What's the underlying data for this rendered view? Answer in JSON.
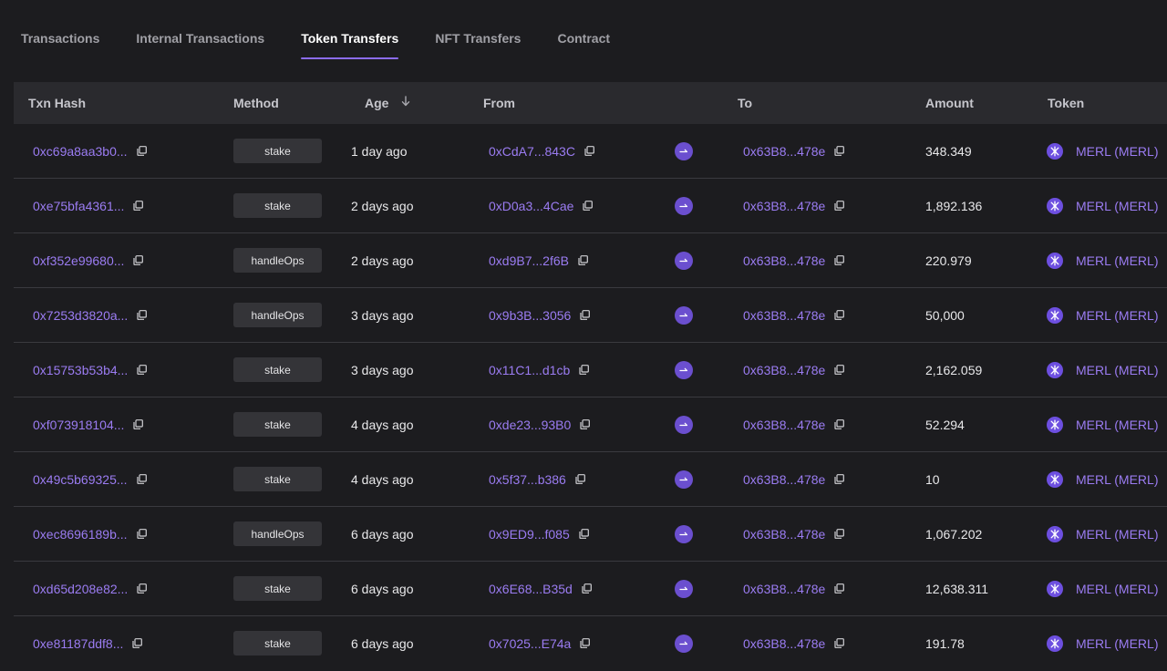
{
  "tabs": [
    {
      "label": "Transactions",
      "active": false
    },
    {
      "label": "Internal Transactions",
      "active": false
    },
    {
      "label": "Token Transfers",
      "active": true
    },
    {
      "label": "NFT Transfers",
      "active": false
    },
    {
      "label": "Contract",
      "active": false
    }
  ],
  "table": {
    "headers": {
      "txn_hash": "Txn Hash",
      "method": "Method",
      "age": "Age",
      "from": "From",
      "to": "To",
      "amount": "Amount",
      "token": "Token"
    },
    "rows": [
      {
        "hash": "0xc69a8aa3b0...",
        "method": "stake",
        "age": "1 day ago",
        "from": "0xCdA7...843C",
        "to": "0x63B8...478e",
        "amount": "348.349",
        "token": "MERL (MERL)"
      },
      {
        "hash": "0xe75bfa4361...",
        "method": "stake",
        "age": "2 days ago",
        "from": "0xD0a3...4Cae",
        "to": "0x63B8...478e",
        "amount": "1,892.136",
        "token": "MERL (MERL)"
      },
      {
        "hash": "0xf352e99680...",
        "method": "handleOps",
        "age": "2 days ago",
        "from": "0xd9B7...2f6B",
        "to": "0x63B8...478e",
        "amount": "220.979",
        "token": "MERL (MERL)"
      },
      {
        "hash": "0x7253d3820a...",
        "method": "handleOps",
        "age": "3 days ago",
        "from": "0x9b3B...3056",
        "to": "0x63B8...478e",
        "amount": "50,000",
        "token": "MERL (MERL)"
      },
      {
        "hash": "0x15753b53b4...",
        "method": "stake",
        "age": "3 days ago",
        "from": "0x11C1...d1cb",
        "to": "0x63B8...478e",
        "amount": "2,162.059",
        "token": "MERL (MERL)"
      },
      {
        "hash": "0xf073918104...",
        "method": "stake",
        "age": "4 days ago",
        "from": "0xde23...93B0",
        "to": "0x63B8...478e",
        "amount": "52.294",
        "token": "MERL (MERL)"
      },
      {
        "hash": "0x49c5b69325...",
        "method": "stake",
        "age": "4 days ago",
        "from": "0x5f37...b386",
        "to": "0x63B8...478e",
        "amount": "10",
        "token": "MERL (MERL)"
      },
      {
        "hash": "0xec8696189b...",
        "method": "handleOps",
        "age": "6 days ago",
        "from": "0x9ED9...f085",
        "to": "0x63B8...478e",
        "amount": "1,067.202",
        "token": "MERL (MERL)"
      },
      {
        "hash": "0xd65d208e82...",
        "method": "stake",
        "age": "6 days ago",
        "from": "0x6E68...B35d",
        "to": "0x63B8...478e",
        "amount": "12,638.311",
        "token": "MERL (MERL)"
      },
      {
        "hash": "0xe81187ddf8...",
        "method": "stake",
        "age": "6 days ago",
        "from": "0x7025...E74a",
        "to": "0x63B8...478e",
        "amount": "191.78",
        "token": "MERL (MERL)"
      }
    ]
  },
  "icons": {
    "copy": "copy-icon",
    "direction": "arrow-right-icon",
    "token": "merl-token-icon",
    "sort": "arrow-down-icon"
  },
  "colors": {
    "accent": "#8b6cf0",
    "link": "#9b7cf2",
    "background": "#1c1c1f",
    "header_bg": "#2a2a2e"
  }
}
